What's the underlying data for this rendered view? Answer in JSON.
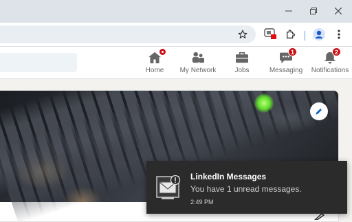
{
  "browser": {
    "window_controls": [
      "minimize",
      "restore",
      "close"
    ],
    "toolbar_icons": [
      "bookmark-star",
      "extension-badge",
      "extensions-puzzle",
      "profile",
      "menu"
    ]
  },
  "linkedin_nav": {
    "items": [
      {
        "label": "Home",
        "icon": "home-icon",
        "badge": ""
      },
      {
        "label": "My Network",
        "icon": "network-icon",
        "badge": ""
      },
      {
        "label": "Jobs",
        "icon": "briefcase-icon",
        "badge": ""
      },
      {
        "label": "Messaging",
        "icon": "messaging-icon",
        "badge": "1"
      },
      {
        "label": "Notifications",
        "icon": "bell-icon",
        "badge": "2"
      }
    ]
  },
  "toast": {
    "title": "LinkedIn Messages",
    "body": "You have 1 unread messages.",
    "time": "2:49 PM"
  },
  "colors": {
    "badge": "#cc1016",
    "accent": "#0a66c2",
    "toast_bg": "#2b2b2b"
  }
}
